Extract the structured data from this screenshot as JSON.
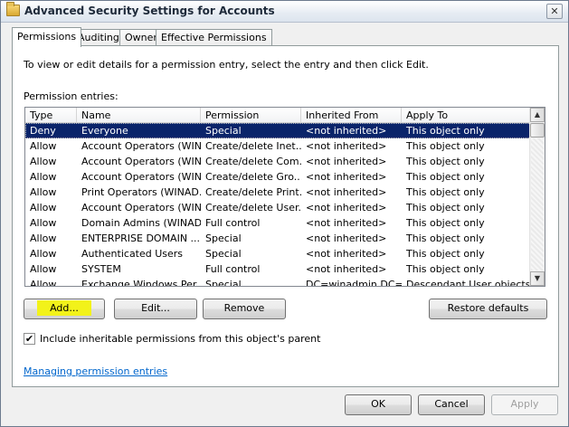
{
  "window": {
    "title": "Advanced Security Settings for Accounts",
    "close_glyph": "✕"
  },
  "tabs": [
    {
      "label": "Permissions",
      "active": true
    },
    {
      "label": "Auditing"
    },
    {
      "label": "Owner"
    },
    {
      "label": "Effective Permissions"
    }
  ],
  "panel": {
    "instruction": "To view or edit details for a permission entry, select the entry and then click Edit.",
    "entries_label": "Permission entries:"
  },
  "table": {
    "columns": [
      "Type",
      "Name",
      "Permission",
      "Inherited From",
      "Apply To"
    ],
    "rows": [
      [
        "Deny",
        "Everyone",
        "Special",
        "<not inherited>",
        "This object only"
      ],
      [
        "Allow",
        "Account Operators (WIN...",
        "Create/delete Inet...",
        "<not inherited>",
        "This object only"
      ],
      [
        "Allow",
        "Account Operators (WIN...",
        "Create/delete Com...",
        "<not inherited>",
        "This object only"
      ],
      [
        "Allow",
        "Account Operators (WIN...",
        "Create/delete Gro...",
        "<not inherited>",
        "This object only"
      ],
      [
        "Allow",
        "Print Operators (WINAD...",
        "Create/delete Print...",
        "<not inherited>",
        "This object only"
      ],
      [
        "Allow",
        "Account Operators (WIN...",
        "Create/delete User...",
        "<not inherited>",
        "This object only"
      ],
      [
        "Allow",
        "Domain Admins (WINAD...",
        "Full control",
        "<not inherited>",
        "This object only"
      ],
      [
        "Allow",
        "ENTERPRISE DOMAIN ...",
        "Special",
        "<not inherited>",
        "This object only"
      ],
      [
        "Allow",
        "Authenticated Users",
        "Special",
        "<not inherited>",
        "This object only"
      ],
      [
        "Allow",
        "SYSTEM",
        "Full control",
        "<not inherited>",
        "This object only"
      ],
      [
        "Allow",
        "Exchange Windows Per...",
        "Special",
        "DC=winadmin,DC=...",
        "Descendant User objects"
      ]
    ],
    "selected_row": 0,
    "scroll_up_glyph": "▲",
    "scroll_down_glyph": "▼"
  },
  "buttons": {
    "add": "Add...",
    "edit": "Edit...",
    "remove": "Remove",
    "restore": "Restore defaults",
    "ok": "OK",
    "cancel": "Cancel",
    "apply": "Apply"
  },
  "include_inheritable": {
    "label": "Include inheritable permissions from this object's parent",
    "checked": true,
    "glyph": "✔"
  },
  "link": "Managing permission entries",
  "icons": [
    "folder-icon",
    "close-icon",
    "scroll-up-icon",
    "scroll-down-icon",
    "checkmark-icon"
  ],
  "colors": {
    "selection": "#0a246a",
    "add_highlight": "#f2f21a",
    "link": "#0066cc"
  }
}
